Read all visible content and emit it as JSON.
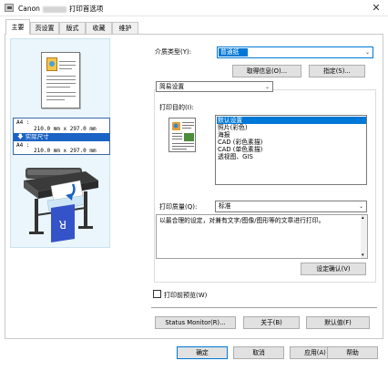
{
  "window": {
    "title_prefix": "Canon",
    "title_suffix": "打印首选项",
    "close_glyph": "✕"
  },
  "tabs": [
    "主要",
    "页设置",
    "版式",
    "收藏",
    "维护"
  ],
  "preview": {
    "paper_line1_label": "A4 :",
    "paper_line1_value": "210.0 mm x 297.0 mm",
    "actual_size_label": "实际尺寸",
    "paper_line2_label": "A4 :",
    "paper_line2_value": "210.0 mm x 297.0 mm"
  },
  "media": {
    "label": "介质类型(Y):",
    "value": "普通纸"
  },
  "buttons": {
    "get_info": "取得信息(O)...",
    "specify": "指定(S)...",
    "confirm_settings": "设定确认(V)",
    "status_monitor": "Status Monitor(R)...",
    "about": "关于(B)",
    "defaults": "默认值(F)",
    "ok": "确定",
    "cancel": "取消",
    "apply": "应用(A)",
    "help": "帮助"
  },
  "mode": {
    "value": "简易设置"
  },
  "purpose": {
    "label": "打印目的(I):",
    "items": [
      "默认设置",
      "照片(彩色)",
      "海报",
      "CAD (彩色素描)",
      "CAD (单色素描)",
      "透视图、GIS"
    ],
    "selected_index": 0
  },
  "quality": {
    "label": "打印质量(Q):",
    "value": "标准"
  },
  "description": "以最合理的设定，对兼有文字/图像/图形等的文章进行打印。",
  "preview_checkbox": {
    "label": "打印前预览(W)",
    "checked": false
  },
  "colors": {
    "accent": "#0078d7",
    "preview_bg": "#eaf6fb",
    "actual_bar": "#1b63c4"
  }
}
